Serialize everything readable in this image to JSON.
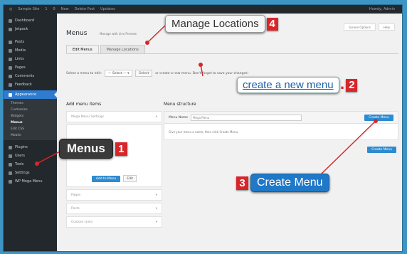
{
  "admin_bar": {
    "site": "Sample Site",
    "items": [
      "1",
      "0",
      "New",
      "Delete Post",
      "Updates"
    ],
    "user": "Howdy, Admin"
  },
  "sidebar": {
    "items": [
      {
        "label": "Dashboard"
      },
      {
        "label": "Jetpack"
      },
      {
        "label": "Posts"
      },
      {
        "label": "Media"
      },
      {
        "label": "Links"
      },
      {
        "label": "Pages"
      },
      {
        "label": "Comments"
      },
      {
        "label": "Feedback"
      },
      {
        "label": "Appearance"
      },
      {
        "label": "Plugins"
      },
      {
        "label": "Users"
      },
      {
        "label": "Tools"
      },
      {
        "label": "Settings"
      },
      {
        "label": "WP Mega Menu"
      }
    ],
    "submenu": [
      "Themes",
      "Customize",
      "Widgets",
      "Menus",
      "Edit CSS",
      "Mobile"
    ]
  },
  "header": {
    "title": "Menus",
    "subtitle": "Manage with Live Preview",
    "help_tabs": [
      "Screen Options",
      "Help"
    ]
  },
  "tabs": [
    {
      "label": "Edit Menus"
    },
    {
      "label": "Manage Locations"
    }
  ],
  "select_row": {
    "label": "Select a menu to edit:",
    "selected": "— Select —",
    "button": "Select",
    "hint": "or create a new menu. Don't forget to save your changes!"
  },
  "add_items": {
    "heading": "Add menu items",
    "panels": [
      "Mega Menu Settings",
      "",
      "Pages",
      "Posts",
      "Custom Links"
    ],
    "submit": "Add to Menu",
    "cancel": "Edit"
  },
  "structure": {
    "heading": "Menu structure",
    "name_label": "Menu Name",
    "name_placeholder": "Mega Menu",
    "create_button": "Create Menu",
    "body_text": "Give your menu a name, then click Create Menu."
  },
  "callouts": {
    "manage_locations": {
      "text": "Manage Locations",
      "num": "4"
    },
    "menus": {
      "text": "Menus",
      "num": "1"
    },
    "create_link": {
      "text": "create a new menu",
      "num": "2"
    },
    "create_menu": {
      "text": "Create Menu",
      "num": "3"
    }
  },
  "colors": {
    "accent": "#2e8bd0",
    "admin_dark": "#23282d",
    "callout_red": "#d7262a",
    "frame": "#3d95c4"
  }
}
